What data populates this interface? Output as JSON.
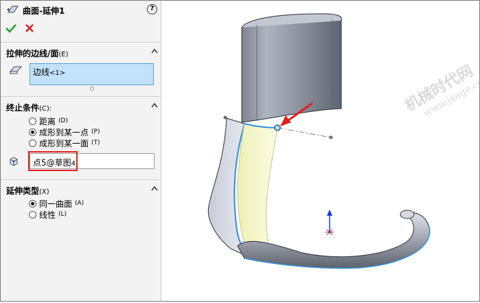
{
  "header": {
    "title": "曲面-延伸1",
    "help_icon": "help-icon",
    "ok_icon": "checkmark-icon",
    "cancel_icon": "close-icon"
  },
  "edges_group": {
    "title": "拉伸的边线/面",
    "hotkey": "(E)",
    "selection_main": "边线",
    "selection_sub": "<1>"
  },
  "end_condition_group": {
    "title": "终止条件",
    "hotkey": "(C):",
    "options": [
      {
        "label": "距离",
        "hotkey": "(D)",
        "selected": false
      },
      {
        "label": "成形到某一点",
        "hotkey": "(P)",
        "selected": true
      },
      {
        "label": "成形到某一面",
        "hotkey": "(T)",
        "selected": false
      }
    ],
    "point_value_main": "点5@草图",
    "point_value_sub": "4"
  },
  "extension_type_group": {
    "title": "延伸类型",
    "hotkey": "(X)",
    "options": [
      {
        "label": "同一曲面",
        "hotkey": "(A)",
        "selected": true
      },
      {
        "label": "线性",
        "hotkey": "(L)",
        "selected": false
      }
    ]
  },
  "watermark": {
    "main": "机械时代网",
    "sub": "www.jxage.com"
  },
  "colors": {
    "selection_bg": "#c2e1fb",
    "highlight_red": "#e0201c",
    "ok_green": "#2e9a2e",
    "surface_yellow": "#f4f6c8",
    "edge_blue": "#2f8fd8"
  }
}
